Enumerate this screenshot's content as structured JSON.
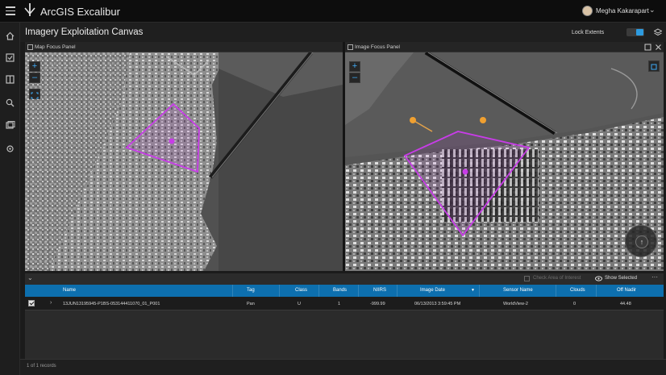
{
  "app": {
    "name": "ArcGIS Excalibur",
    "user": "Megha Kakarapart"
  },
  "page": {
    "title": "Imagery Exploitation Canvas",
    "lock_extents_label": "Lock Extents"
  },
  "panels": {
    "left": {
      "title": "Map Focus Panel"
    },
    "right": {
      "title": "Image Focus Panel"
    }
  },
  "controls": {
    "zoom_in": "+",
    "zoom_out": "–",
    "more": "···"
  },
  "table": {
    "check_area_label": "Check Area of Interest",
    "show_selected_label": "Show Selected",
    "columns": [
      "Name",
      "Tag",
      "Class",
      "Bands",
      "NIIRS",
      "Image Date",
      "Sensor Name",
      "Clouds",
      "Off Nadir"
    ],
    "rows": [
      {
        "name": "13JUN13195945-P1BS-053144411070_01_P001",
        "tag": "Pan",
        "class": "U",
        "bands": "1",
        "niirs": "-999.99",
        "image_date": "06/13/2013 3:59:45 PM",
        "sensor": "WorldView-2",
        "clouds": "0",
        "off_nadir": "44.48"
      }
    ],
    "record_count": "1 of 1 records"
  },
  "colors": {
    "accent": "#2d9be0",
    "header_blue": "#0d6fae",
    "aoi": "#c83ce8",
    "marker": "#f0a030"
  },
  "icons": [
    "home-icon",
    "checklist-icon",
    "book-icon",
    "search-icon",
    "gallery-icon",
    "settings-icon",
    "layers-icon",
    "compass-icon"
  ]
}
